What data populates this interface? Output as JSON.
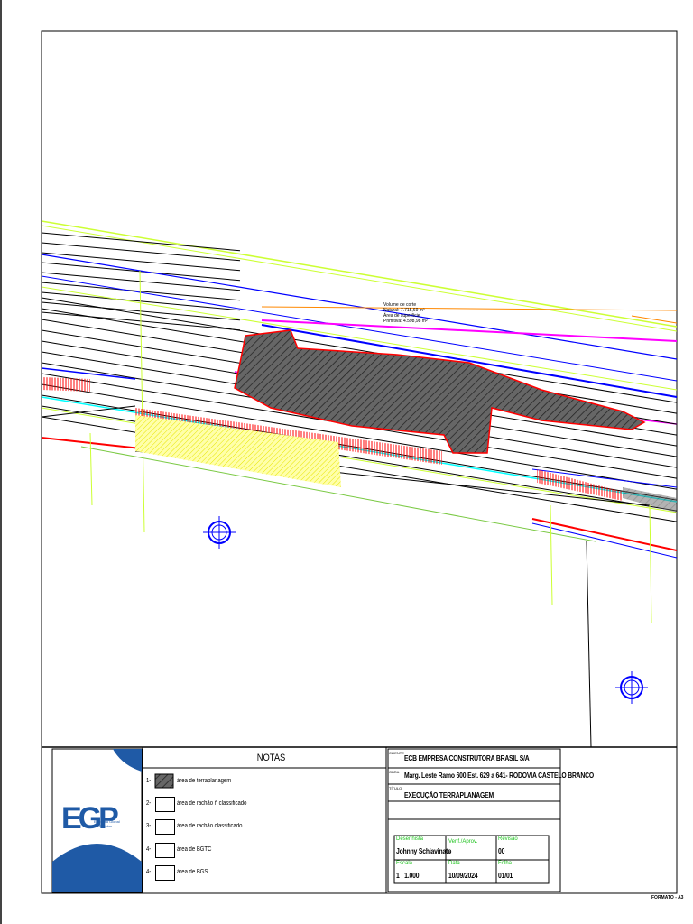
{
  "drawing": {
    "annotation": {
      "line1": "Volume de corte",
      "line2": "Natural:  7.715,69 m³",
      "line3": "Área de superfície",
      "line4": "Primitiva:  4.598,98 m²"
    },
    "colors": {
      "hatch": "#555555",
      "outline": "#ff0000",
      "lime": "#ccff33",
      "magenta": "#ff00ff",
      "blue": "#0000ff",
      "cyan": "#00ffff",
      "yellow": "#ffff66"
    }
  },
  "title_block": {
    "logo": {
      "letters": "EGP",
      "subtitle": "Empresa Global de Projetos"
    },
    "notes_title": "NOTAS",
    "notes": [
      {
        "num": "1-",
        "text": "área de terraplanagem",
        "hatched": true
      },
      {
        "num": "2-",
        "text": "área de rachão ñ classificado",
        "hatched": false
      },
      {
        "num": "3-",
        "text": "área de rachão classificado",
        "hatched": false
      },
      {
        "num": "4-",
        "text": "área de BGTC",
        "hatched": false
      },
      {
        "num": "4-",
        "text": "área de BGS",
        "hatched": false
      }
    ],
    "cliente_label": "CLIENTE",
    "cliente": "ECB EMPRESA CONSTRUTORA BRASIL S/A",
    "obra_label": "OBRA",
    "obra": "Marg. Leste Ramo 600 Est. 629 a 641- RODOVIA CASTELO BRANCO",
    "titulo_label": "TÍTULO",
    "titulo": "EXECUÇÃO TERRAPLANAGEM",
    "desenhista_label": "Desenhista",
    "desenhista": "Johnny Schiavinato",
    "verif_label": "Verif./Aprov.",
    "verif": "-",
    "revisao_label": "Revisão",
    "revisao": "00",
    "escala_label": "Escala",
    "escala": "1 : 1.000",
    "data_label": "Data",
    "data": "10/09/2024",
    "folha_label": "Folha",
    "folha": "01/01",
    "formato": "FORMATO - A3"
  }
}
